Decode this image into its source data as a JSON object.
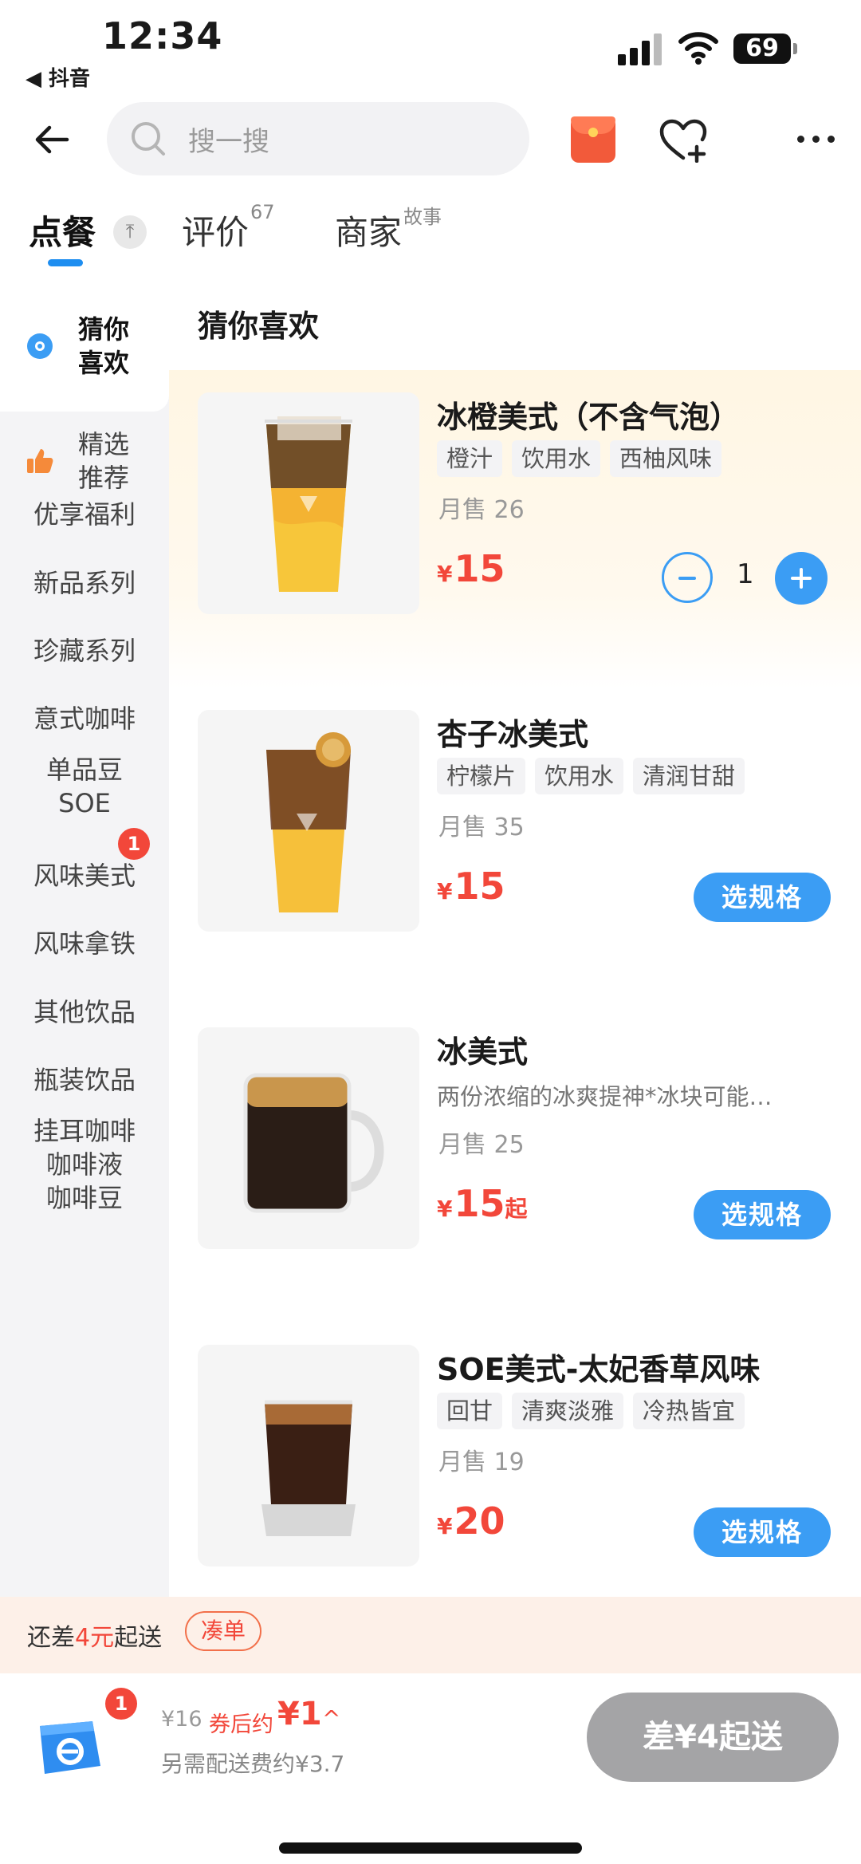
{
  "status_bar": {
    "time": "12:34",
    "back_app": "◀ 抖音",
    "battery": "69"
  },
  "header": {
    "search_placeholder": "搜一搜"
  },
  "tabs": [
    {
      "label": "点餐",
      "sup": ""
    },
    {
      "label": "评价",
      "sup": "67"
    },
    {
      "label": "商家",
      "sup": "故事"
    }
  ],
  "sidebar": {
    "items": [
      {
        "label_line1": "猜你",
        "label_line2": "喜欢",
        "icon": "eye-icon",
        "active": true
      },
      {
        "label_line1": "精选",
        "label_line2": "推荐",
        "icon": "thumbs-up-icon"
      },
      {
        "label": "优享福利"
      },
      {
        "label": "新品系列"
      },
      {
        "label": "珍藏系列"
      },
      {
        "label": "意式咖啡"
      },
      {
        "label_line1": "单品豆",
        "label_line2": "SOE"
      },
      {
        "label": "风味美式",
        "badge": "1"
      },
      {
        "label": "风味拿铁"
      },
      {
        "label": "其他饮品"
      },
      {
        "label": "瓶装饮品"
      },
      {
        "label_line1": "挂耳咖啡",
        "label_line2": "咖啡液",
        "label_line3": "咖啡豆"
      }
    ]
  },
  "main": {
    "section_title": "猜你喜欢",
    "products": [
      {
        "name": "冰橙美式（不含气泡）",
        "tags": [
          "橙汁",
          "饮用水",
          "西柚风味"
        ],
        "sales": "月售 26",
        "currency": "¥",
        "price": "15",
        "quantity": "1"
      },
      {
        "name": "杏子冰美式",
        "tags": [
          "柠檬片",
          "饮用水",
          "清润甘甜"
        ],
        "sales": "月售 35",
        "currency": "¥",
        "price": "15",
        "button": "选规格"
      },
      {
        "name": "冰美式",
        "desc": "两份浓缩的冰爽提神*冰块可能…",
        "sales": "月售 25",
        "currency": "¥",
        "price": "15",
        "price_suffix": "起",
        "button": "选规格"
      },
      {
        "name": "SOE美式-太妃香草风味",
        "tags": [
          "回甘",
          "清爽淡雅",
          "冷热皆宜"
        ],
        "sales": "月售 19",
        "currency": "¥",
        "price": "20",
        "button": "选规格"
      }
    ]
  },
  "notice": {
    "prefix": "还差",
    "amount": "4元",
    "suffix": "起送",
    "button": "凑单"
  },
  "cart_bar": {
    "badge": "1",
    "original_price": "¥16",
    "after_label": "券后约",
    "after_price": "¥1",
    "delivery_note": "另需配送费约¥3.7",
    "submit": "差¥4起送"
  },
  "colors": {
    "accent": "#3b9df4",
    "price": "#f2473a",
    "highlight_bg": "#fff6e3"
  }
}
